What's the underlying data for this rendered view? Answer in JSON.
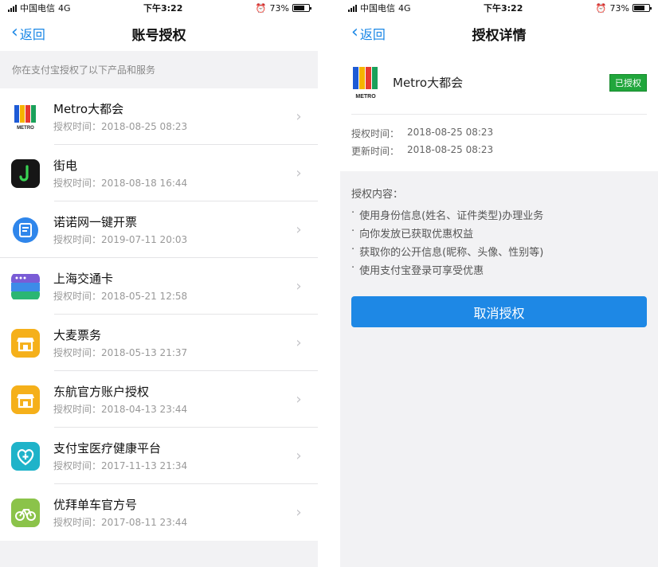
{
  "status_bar": {
    "carrier": "中国电信",
    "signal_extra": "4G",
    "time": "下午3:22",
    "battery": "73%",
    "battery_level": 0.73
  },
  "left": {
    "back_label": "返回",
    "title": "账号授权",
    "section_hint": "你在支付宝授权了以下产品和服务",
    "apps": [
      {
        "name": "Metro大都会",
        "time": "授权时间：2018-08-25 08:23",
        "icon": "metro-logo-icon"
      },
      {
        "name": "街电",
        "time": "授权时间：2018-08-18 16:44",
        "icon": "jiedian-icon"
      },
      {
        "name": "诺诺网一键开票",
        "time": "授权时间：2019-07-11 20:03",
        "icon": "invoice-icon"
      },
      {
        "name": "上海交通卡",
        "time": "授权时间：2018-05-21 12:58",
        "icon": "transit-card-icon"
      },
      {
        "name": "大麦票务",
        "time": "授权时间：2018-05-13 21:37",
        "icon": "store-icon"
      },
      {
        "name": "东航官方账户授权",
        "time": "授权时间：2018-04-13 23:44",
        "icon": "store-icon"
      },
      {
        "name": "支付宝医疗健康平台",
        "time": "授权时间：2017-11-13 21:34",
        "icon": "health-icon"
      },
      {
        "name": "优拜单车官方号",
        "time": "授权时间：2017-08-11 23:44",
        "icon": "bike-icon"
      }
    ]
  },
  "right": {
    "back_label": "返回",
    "title": "授权详情",
    "app_name": "Metro大都会",
    "badge": "已授权",
    "auth_time_label": "授权时间：",
    "auth_time": "2018-08-25 08:23",
    "update_time_label": "更新时间：",
    "update_time": "2018-08-25 08:23",
    "perm_title": "授权内容：",
    "perms": [
      "使用身份信息(姓名、证件类型)办理业务",
      "向你发放已获取优惠权益",
      "获取你的公开信息(昵称、头像、性别等)",
      "使用支付宝登录可享受优惠"
    ],
    "revoke_label": "取消授权"
  }
}
